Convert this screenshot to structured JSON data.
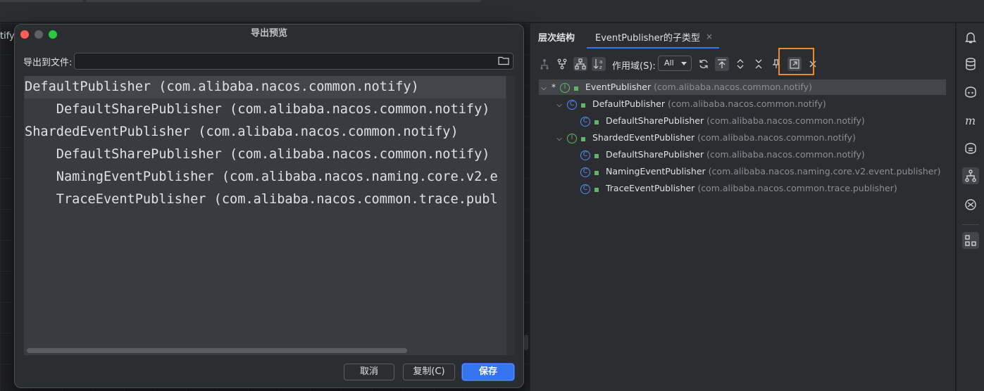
{
  "editor": {
    "tab_fragment": "tify"
  },
  "dialog": {
    "title": "导出预览",
    "file_label": "导出到文件:",
    "file_value": "",
    "preview_lines": [
      "DefaultPublisher (com.alibaba.nacos.common.notify)",
      "    DefaultSharePublisher (com.alibaba.nacos.common.notify)",
      "ShardedEventPublisher (com.alibaba.nacos.common.notify)",
      "    DefaultSharePublisher (com.alibaba.nacos.common.notify)",
      "    NamingEventPublisher (com.alibaba.nacos.naming.core.v2.e",
      "    TraceEventPublisher (com.alibaba.nacos.common.trace.publ"
    ],
    "buttons": {
      "cancel": "取消",
      "copy": "复制(C)",
      "save": "保存"
    }
  },
  "hierarchy": {
    "tab_hierarchy": "层次结构",
    "tab_subtypes": "EventPublisher的子类型",
    "tab_close": "×",
    "scope_label": "作用域(S):",
    "scope_value": "All",
    "tree": [
      {
        "star": "*",
        "icon": "I",
        "name": "EventPublisher",
        "pkg": "(com.alibaba.nacos.common.notify)"
      },
      {
        "icon": "C",
        "name": "DefaultPublisher",
        "pkg": "(com.alibaba.nacos.common.notify)"
      },
      {
        "icon": "C",
        "name": "DefaultSharePublisher",
        "pkg": "(com.alibaba.nacos.common.notify)"
      },
      {
        "icon": "I",
        "name": "ShardedEventPublisher",
        "pkg": "(com.alibaba.nacos.common.notify)"
      },
      {
        "icon": "C",
        "name": "DefaultSharePublisher",
        "pkg": "(com.alibaba.nacos.common.notify)"
      },
      {
        "icon": "C",
        "name": "NamingEventPublisher",
        "pkg": "(com.alibaba.nacos.naming.core.v2.event.publisher)"
      },
      {
        "icon": "C",
        "name": "TraceEventPublisher",
        "pkg": "(com.alibaba.nacos.common.trace.publisher)"
      }
    ]
  },
  "strip_icons": [
    "bell-icon",
    "database-icon",
    "copilot-icon",
    "m-icon",
    "ai-assistant-icon",
    "hierarchy-icon",
    "plugin-icon",
    "structure-icon"
  ],
  "colors": {
    "accent": "#3574f0",
    "highlight": "#f08a24",
    "interface": "#5fb865",
    "class": "#548af7"
  }
}
